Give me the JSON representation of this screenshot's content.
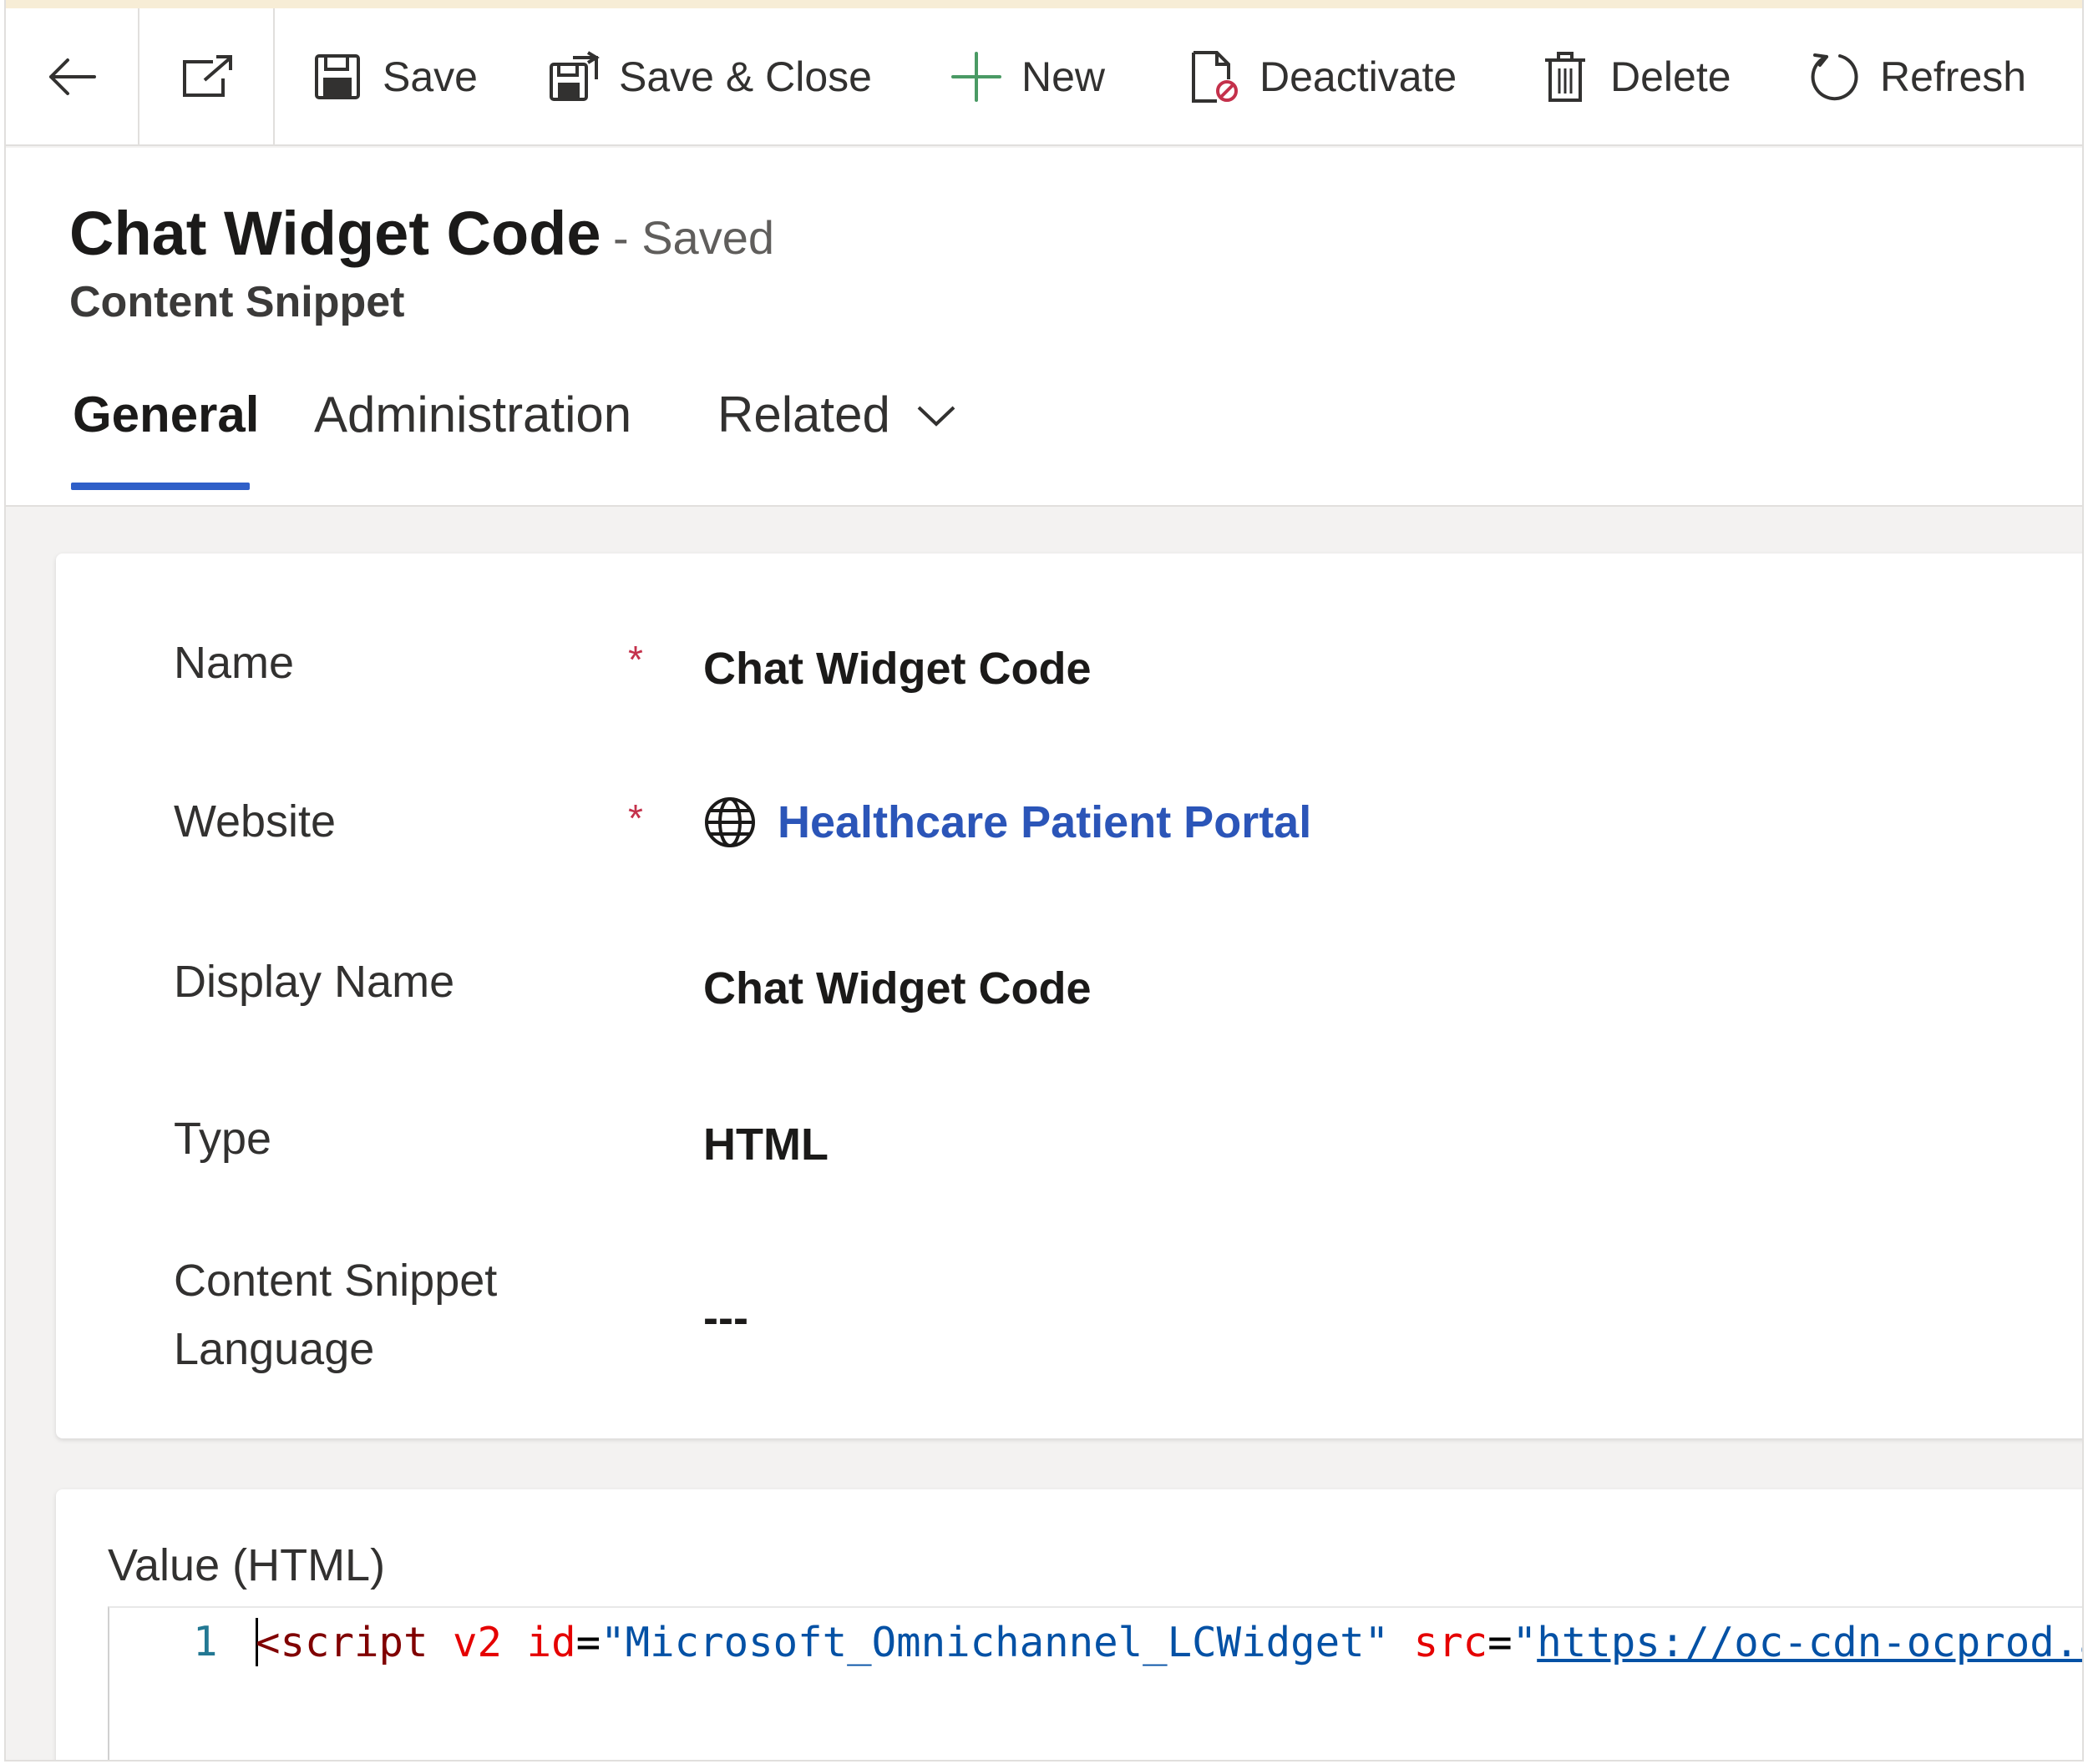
{
  "commandbar": {
    "save_label": "Save",
    "save_close_label": "Save & Close",
    "new_label": "New",
    "deactivate_label": "Deactivate",
    "delete_label": "Delete",
    "refresh_label": "Refresh"
  },
  "header": {
    "title": "Chat Widget Code",
    "status": "- Saved",
    "entity": "Content Snippet"
  },
  "tabs": [
    {
      "label": "General",
      "selected": true
    },
    {
      "label": "Administration",
      "selected": false
    },
    {
      "label": "Related",
      "selected": false
    }
  ],
  "form": {
    "fields": [
      {
        "label": "Name",
        "required": true,
        "value": "Chat Widget Code"
      },
      {
        "label": "Website",
        "required": true,
        "value": "Healthcare Patient Portal"
      },
      {
        "label": "Display Name",
        "required": false,
        "value": "Chat Widget Code"
      },
      {
        "label": "Type",
        "required": false,
        "value": "HTML"
      },
      {
        "label": "Content Snippet Language",
        "required": false,
        "value": "---"
      }
    ]
  },
  "value_section": {
    "label": "Value (HTML)",
    "line_number": "1",
    "code": {
      "open": "<",
      "tag": "script",
      "attr1": "v2",
      "attr2": "id",
      "eq": "=",
      "id_value": "\"Microsoft_Omnichannel_LCWidget\"",
      "attr3": "src",
      "quote": "\"",
      "url": "https://oc-cdn-ocprod.az"
    }
  },
  "colors": {
    "accent": "#2f5fc8",
    "link": "#2b55b8",
    "required": "#c4314b",
    "new_icon": "#4a9a64"
  }
}
